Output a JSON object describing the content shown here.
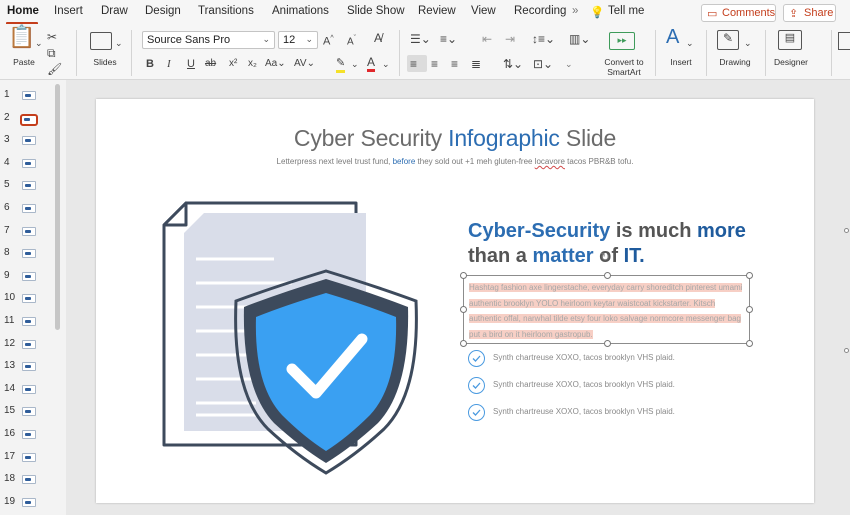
{
  "tabs": [
    {
      "label": "Home",
      "active": true
    },
    {
      "label": "Insert"
    },
    {
      "label": "Draw"
    },
    {
      "label": "Design"
    },
    {
      "label": "Transitions"
    },
    {
      "label": "Animations"
    },
    {
      "label": "Slide Show"
    },
    {
      "label": "Review"
    },
    {
      "label": "View"
    },
    {
      "label": "Recording"
    }
  ],
  "tell_me": "Tell me",
  "comments_label": "Comments",
  "share_label": "Share",
  "ribbon": {
    "paste_label": "Paste",
    "slides_label": "Slides",
    "font_name": "Source Sans Pro",
    "font_size": "12",
    "convert_smartart_label_1": "Convert to",
    "convert_smartart_label_2": "SmartArt",
    "insert_label": "Insert",
    "drawing_label": "Drawing",
    "designer_label": "Designer",
    "accent_color": "#c43e1c",
    "highlight_color": "#f5e12a",
    "font_color": "#e0282c"
  },
  "thumbnails": {
    "numbers": [
      "1",
      "2",
      "3",
      "4",
      "5",
      "6",
      "7",
      "8",
      "9",
      "10",
      "11",
      "12",
      "13",
      "14",
      "15",
      "16",
      "17",
      "18",
      "19"
    ],
    "selected": "2"
  },
  "slide": {
    "title_part1": "Cyber Security ",
    "title_part2": "Infographic",
    "title_part3": " Slide",
    "subtitle_part1": "Letterpress next level trust fund, ",
    "subtitle_part2": "before",
    "subtitle_part3": " they sold out +1 meh gluten-free ",
    "subtitle_part4": "locavore",
    "subtitle_part5": " tacos PBR&B tofu.",
    "headline_part1": "Cyber-Security",
    "headline_part2": " is much ",
    "headline_part3": "more",
    "headline_part4": "than a ",
    "headline_part5": "matter",
    "headline_part6": " of ",
    "headline_part7": "IT.",
    "body_text": "Hashtag fashion axe lingerstache, everyday carry shoreditch pinterest umami authentic brooklyn YOLO heirloom keytar waistcoat kickstarter. Kitsch authentic offal, narwhal tilde etsy four loko salvage normcore messenger bag put a bird on it heirloom gastropub.",
    "bullets": [
      "Synth chartreuse XOXO, tacos brooklyn VHS plaid.",
      "Synth chartreuse XOXO, tacos brooklyn VHS plaid.",
      "Synth chartreuse XOXO, tacos brooklyn VHS plaid."
    ],
    "shield_color": "#3aa0f2",
    "shield_dark": "#3d4a5c",
    "doc_color": "#d9dde9"
  }
}
